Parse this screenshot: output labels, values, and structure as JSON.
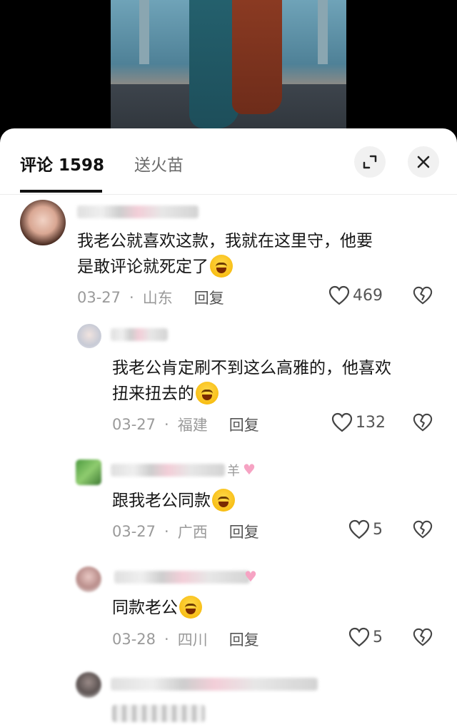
{
  "tabs": {
    "comments_label": "评论 1598",
    "gift_label": "送火苗"
  },
  "icons": {
    "expand": "expand-icon",
    "close": "close-icon",
    "like": "heart-outline-icon",
    "dislike": "broken-heart-icon"
  },
  "comments": [
    {
      "text_line1": "我老公就喜欢这款，我就在这里守，他要",
      "text_line2": "是敢评论就死定了",
      "date": "03-27",
      "location": "山东",
      "reply": "回复",
      "likes": "469"
    },
    {
      "text_line1": "我老公肯定刷不到这么高雅的，他喜欢",
      "text_line2": "扭来扭去的",
      "date": "03-27",
      "location": "福建",
      "reply": "回复",
      "likes": "132"
    },
    {
      "text_line1": "跟我老公同款",
      "name_tail": "羊",
      "date": "03-27",
      "location": "广西",
      "reply": "回复",
      "likes": "5"
    },
    {
      "text_line1": "同款老公",
      "date": "03-28",
      "location": "四川",
      "reply": "回复",
      "likes": "5"
    }
  ]
}
